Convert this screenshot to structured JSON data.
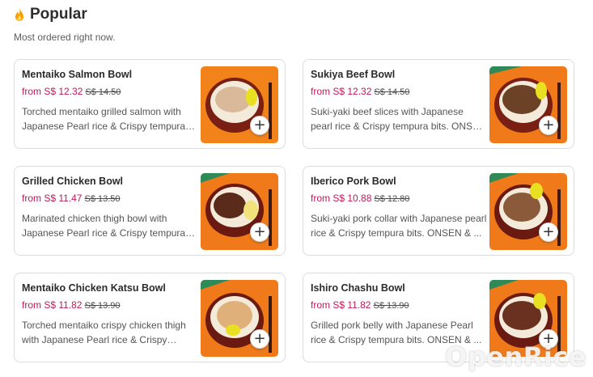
{
  "section": {
    "title": "Popular",
    "subtitle": "Most ordered right now.",
    "icon": "flame-icon"
  },
  "items": [
    {
      "name": "Mentaiko Salmon Bowl",
      "price": "from S$ 12.32",
      "old_price": "S$ 14.50",
      "description": "Torched mentaiko grilled salmon with Japanese Pearl rice & Crispy tempura bits. ONSEN & ...",
      "topping": "#d9b99a",
      "add_label": "+"
    },
    {
      "name": "Sukiya Beef Bowl",
      "price": "from S$ 12.32",
      "old_price": "S$ 14.50",
      "description": "Suki-yaki beef slices with Japanese pearl rice & Crispy tempura bits. ONSEN & ...",
      "topping": "#6b4226",
      "add_label": "+"
    },
    {
      "name": "Grilled Chicken Bowl",
      "price": "from S$ 11.47",
      "old_price": "S$ 13.50",
      "description": "Marinated chicken thigh bowl with Japanese Pearl rice & Crispy tempura bits. ONSEN & ...",
      "topping": "#5a2a1a",
      "add_label": "+"
    },
    {
      "name": "Iberico Pork Bowl",
      "price": "from S$ 10.88",
      "old_price": "S$ 12.80",
      "description": "Suki-yaki pork collar with Japanese pearl rice & Crispy tempura bits. ONSEN & ...",
      "topping": "#8a5a3a",
      "add_label": "+"
    },
    {
      "name": "Mentaiko Chicken Katsu Bowl",
      "price": "from S$ 11.82",
      "old_price": "S$ 13.90",
      "description": "Torched mentaiko crispy chicken thigh with Japanese Pearl rice & Crispy tempura bits. ...",
      "topping": "#e0b07a",
      "add_label": "+"
    },
    {
      "name": "Ishiro Chashu Bowl",
      "price": "from S$ 11.82",
      "old_price": "S$ 13.90",
      "description": "Grilled pork belly with Japanese Pearl rice & Crispy tempura bits. ONSEN & ...",
      "topping": "#6a3020",
      "add_label": "+"
    }
  ],
  "watermark": "OpenRice",
  "colors": {
    "price": "#c2185b",
    "thumb_orange": "#f07a1a",
    "thumb_green": "#2e8b57"
  }
}
